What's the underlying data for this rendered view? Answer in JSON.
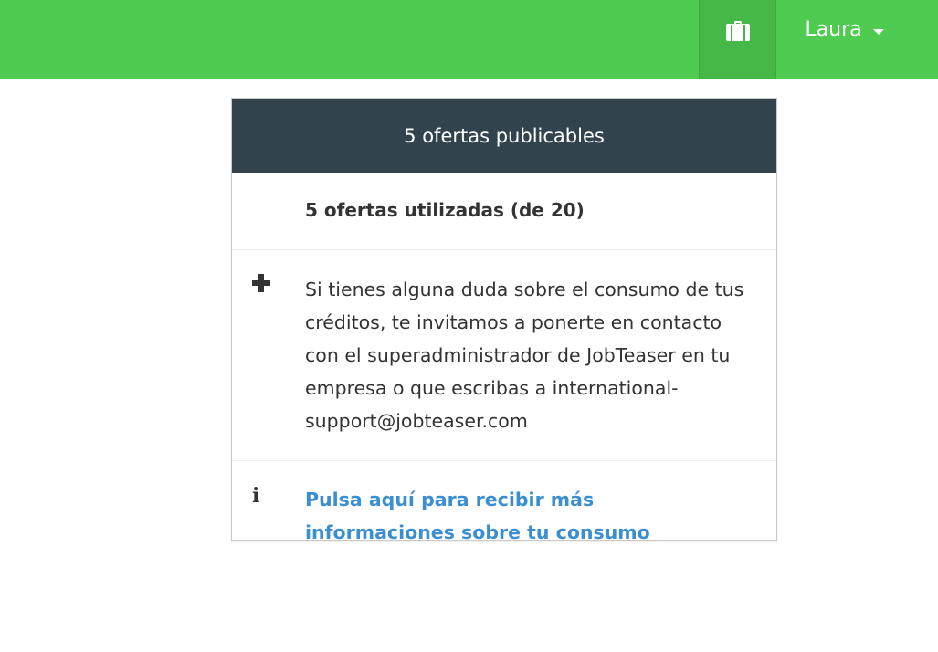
{
  "colors": {
    "accent": "#4ecb50",
    "header": "#33434e",
    "link": "#3b8fd1"
  },
  "nav": {
    "briefcase_icon": "briefcase-icon",
    "user_name": "Laura"
  },
  "card": {
    "header_title": "5 ofertas publicables",
    "used_text": "5 ofertas utilizadas (de 20)",
    "help_icon": "plus-icon",
    "help_text": "Si tienes alguna duda sobre el consumo de tus créditos, te invitamos a ponerte en contacto con el superadministrador de JobTeaser en tu empresa o que escribas a international-support@jobteaser.com",
    "info_icon": "i",
    "info_link": "Pulsa aquí para recibir más informaciones sobre tu consumo"
  }
}
